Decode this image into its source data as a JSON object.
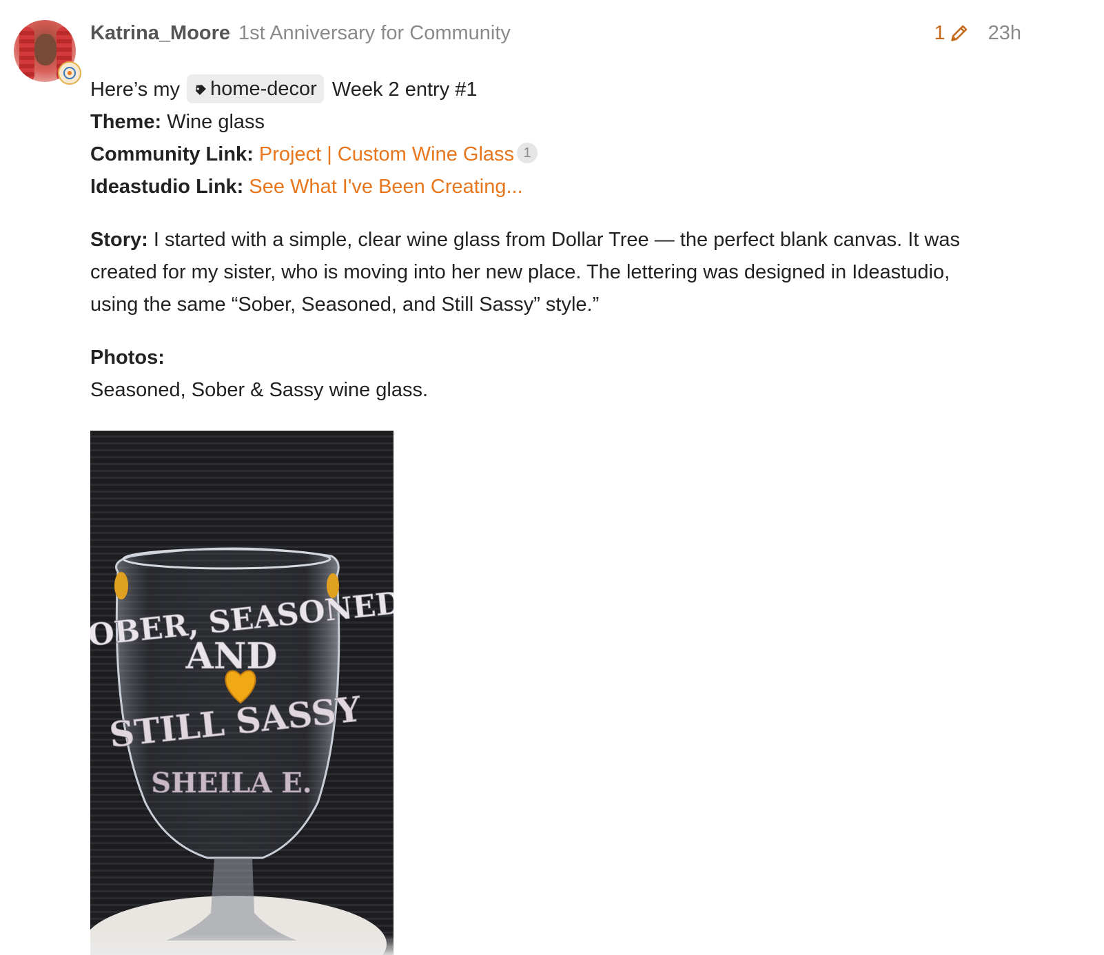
{
  "post": {
    "username": "Katrina_Moore",
    "user_title": "1st Anniversary for Community",
    "edit_count": "1",
    "age": "23h",
    "avatar_icon": "user-avatar",
    "edit_icon": "pencil-icon"
  },
  "body": {
    "intro_prefix": "Here’s my",
    "tag": "home-decor",
    "tag_icon": "tag-icon",
    "intro_suffix": "Week 2 entry #1",
    "theme_label": "Theme:",
    "theme_value": "Wine glass",
    "community_label": "Community Link:",
    "community_link": "Project | Custom Wine Glass",
    "community_link_clicks": "1",
    "ideastudio_label": "Ideastudio Link:",
    "ideastudio_link": "See What I've Been Creating...",
    "story_label": "Story:",
    "story_text": "I started with a simple, clear wine glass from Dollar Tree — the perfect blank canvas. It was created for my sister, who is moving into her new place. The lettering was designed in Ideastudio, using the same “Sober, Seasoned, and Still Sassy” style.”",
    "photos_label": "Photos:",
    "photo_caption": "Seasoned, Sober & Sassy wine glass."
  },
  "photo": {
    "line1": "SOBER, SEASONED",
    "line2": "AND",
    "line3": "STILL SASSY",
    "line4": "SHEILA E."
  },
  "colors": {
    "link": "#e8761d",
    "edit": "#c56a1a",
    "meta": "#8a8a8a"
  }
}
